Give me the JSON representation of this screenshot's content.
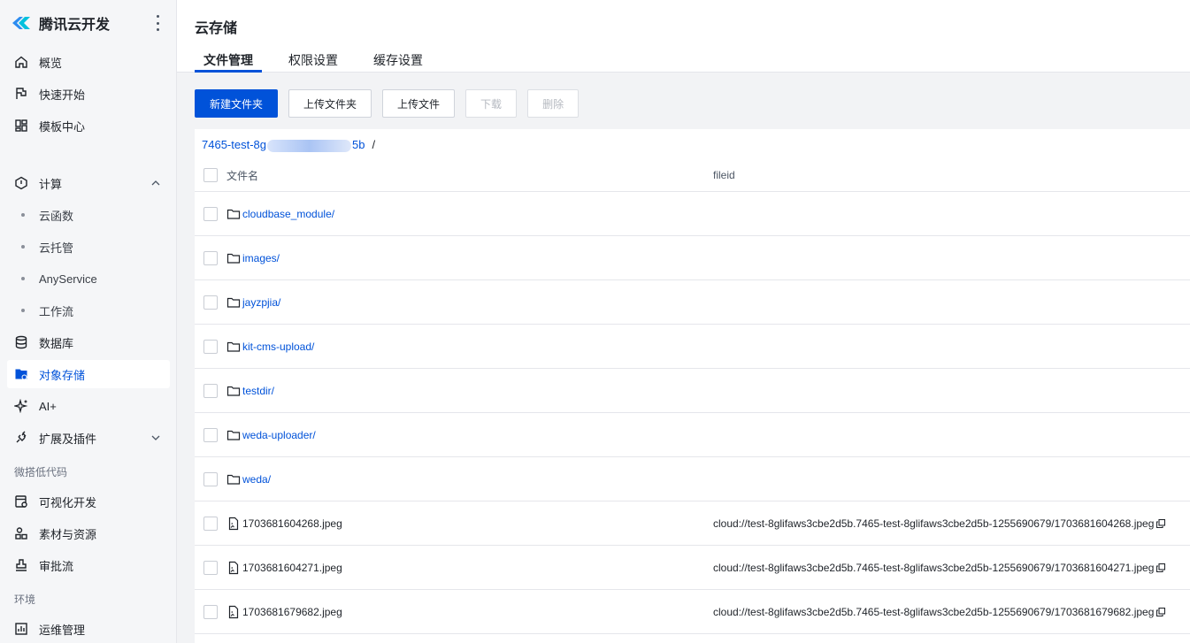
{
  "brand": {
    "name": "腾讯云开发"
  },
  "sidebar": {
    "items": [
      {
        "label": "概览",
        "icon": "home-icon"
      },
      {
        "label": "快速开始",
        "icon": "flag-icon"
      },
      {
        "label": "模板中心",
        "icon": "grid-icon"
      },
      {
        "label": "计算",
        "icon": "hexagon-icon"
      },
      {
        "label": "云函数"
      },
      {
        "label": "云托管"
      },
      {
        "label": "AnyService"
      },
      {
        "label": "工作流"
      },
      {
        "label": "数据库",
        "icon": "database-icon"
      },
      {
        "label": "对象存储",
        "icon": "storage-icon"
      },
      {
        "label": "AI+",
        "icon": "sparkle-icon"
      },
      {
        "label": "扩展及插件",
        "icon": "plugin-icon"
      },
      {
        "label": "可视化开发",
        "icon": "visual-dev-icon"
      },
      {
        "label": "素材与资源",
        "icon": "assets-icon"
      },
      {
        "label": "审批流",
        "icon": "stamp-icon"
      },
      {
        "label": "运维管理",
        "icon": "chart-icon"
      }
    ],
    "groups": {
      "lowcode": "微搭低代码",
      "env": "环境"
    },
    "accent_color": "#0052d9"
  },
  "page": {
    "title": "云存储",
    "tabs": [
      "文件管理",
      "权限设置",
      "缓存设置"
    ]
  },
  "toolbar": {
    "new_folder": "新建文件夹",
    "upload_folder": "上传文件夹",
    "upload_file": "上传文件",
    "download": "下载",
    "delete": "删除"
  },
  "breadcrumb": {
    "prefix": "7465-test-8g",
    "suffix": "5b",
    "sep": "/"
  },
  "table": {
    "headers": {
      "name": "文件名",
      "fileid": "fileid"
    },
    "rows": [
      {
        "name": "cloudbase_module/",
        "type": "folder",
        "fileid": ""
      },
      {
        "name": "images/",
        "type": "folder",
        "fileid": ""
      },
      {
        "name": "jayzpjia/",
        "type": "folder",
        "fileid": ""
      },
      {
        "name": "kit-cms-upload/",
        "type": "folder",
        "fileid": ""
      },
      {
        "name": "testdir/",
        "type": "folder",
        "fileid": ""
      },
      {
        "name": "weda-uploader/",
        "type": "folder",
        "fileid": ""
      },
      {
        "name": "weda/",
        "type": "folder",
        "fileid": ""
      },
      {
        "name": "1703681604268.jpeg",
        "type": "file",
        "fileid": "cloud://test-8glifaws3cbe2d5b.7465-test-8glifaws3cbe2d5b-1255690679/1703681604268.jpeg"
      },
      {
        "name": "1703681604271.jpeg",
        "type": "file",
        "fileid": "cloud://test-8glifaws3cbe2d5b.7465-test-8glifaws3cbe2d5b-1255690679/1703681604271.jpeg"
      },
      {
        "name": "1703681679682.jpeg",
        "type": "file",
        "fileid": "cloud://test-8glifaws3cbe2d5b.7465-test-8glifaws3cbe2d5b-1255690679/1703681679682.jpeg"
      }
    ]
  }
}
